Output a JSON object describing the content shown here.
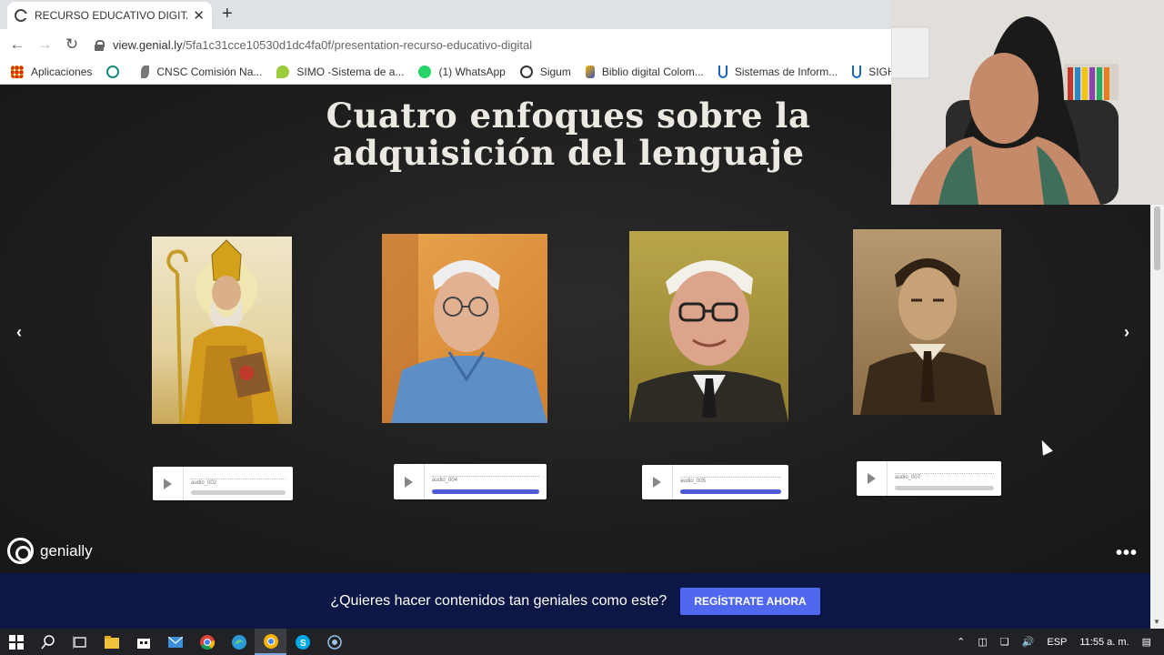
{
  "browser": {
    "tab_title": "RECURSO EDUCATIVO DIGITAL p",
    "new_tab_symbol": "+",
    "close_symbol": "✕",
    "url_host": "view.genial.ly",
    "url_path": "/5fa1c31cce10530d1dc4fa0f/presentation-recurso-educativo-digital"
  },
  "bookmarks": [
    {
      "label": "Aplicaciones",
      "icon": "apps-grid-icon",
      "color": "#e8710a"
    },
    {
      "label": "",
      "icon": "globe-icon",
      "color": "#1a73e8"
    },
    {
      "label": "CNSC Comisión Na...",
      "icon": "cnsc-icon",
      "color": "#555555"
    },
    {
      "label": "SIMO -Sistema de a...",
      "icon": "simo-icon",
      "color": "#8bc34a"
    },
    {
      "label": "(1) WhatsApp",
      "icon": "whatsapp-icon",
      "color": "#25d366"
    },
    {
      "label": "Sigum",
      "icon": "sigum-icon",
      "color": "#333333"
    },
    {
      "label": "Biblio digital Colom...",
      "icon": "biblio-icon",
      "color": "#3f51b5"
    },
    {
      "label": "Sistemas de Inform...",
      "icon": "sistemas-icon",
      "color": "#1565c0"
    },
    {
      "label": "SIGHUM - Si",
      "icon": "sighum-icon",
      "color": "#1565c0"
    }
  ],
  "slide": {
    "title_line1": "Cuatro enfoques sobre la",
    "title_line2": "adquisición del lenguaje",
    "audios": [
      {
        "label": "audio_002",
        "active": false
      },
      {
        "label": "audio_004",
        "active": true
      },
      {
        "label": "audio_005",
        "active": true
      },
      {
        "label": "audio_007",
        "active": false
      }
    ]
  },
  "genially": {
    "brand": "genially",
    "more_symbol": "•••"
  },
  "cta": {
    "question": "¿Quieres hacer contenidos tan geniales como este?",
    "button": "REGÍSTRATE AHORA"
  },
  "taskbar": {
    "language": "ESP",
    "time": "11:55 a. m."
  },
  "colors": {
    "cta_bg": "#0d1745",
    "cta_button": "#5067f0",
    "audio_progress": "#4f5bd5"
  }
}
